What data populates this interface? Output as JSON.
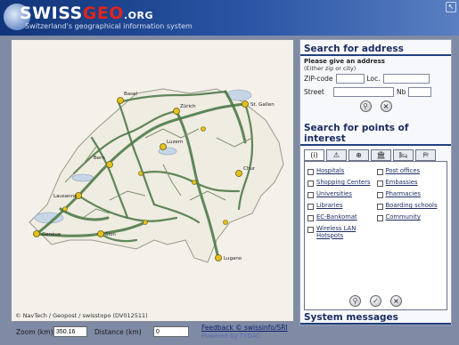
{
  "header": {
    "logo_swiss": "SWISS",
    "logo_geo": "GEO",
    "logo_org": ".ORG",
    "tagline": "Switzerland's geographical information system",
    "corner_glyph": "↖"
  },
  "map": {
    "copyright": "© NavTech / Geopost / swisstopo (DV012511)",
    "city_labels": [
      "Basel",
      "Zürich",
      "St. Gallen",
      "Luzern",
      "Genève",
      "Sion",
      "Lugano",
      "Bern",
      "Chur",
      "Lausanne"
    ],
    "colors": {
      "land": "#f3f1ea",
      "road": "#4f7b4a",
      "city": "#e3c21b"
    }
  },
  "address": {
    "title": "Search for address",
    "hint": "Please give an address",
    "hint_sub": "(Either zip or city)",
    "zip_label": "ZIP-code",
    "loc_label": "Loc.",
    "street_label": "Street",
    "nb_label": "Nb",
    "zip_value": "",
    "loc_value": "",
    "street_value": "",
    "nb_value": "",
    "search_icon": "search-icon",
    "clear_icon": "close-icon"
  },
  "poi": {
    "title": "Search for points of interest",
    "tabs": [
      "(i)",
      "⚠",
      "⊕",
      "🏛",
      "🛏",
      "⛿"
    ],
    "items": [
      "Hospitals",
      "Post offices",
      "Shopping Centers",
      "Embassies",
      "Universities",
      "Pharmacies",
      "Libraries",
      "Boarding schools",
      "EC-Bankomat",
      "Community",
      "Wireless LAN Hotspots",
      ""
    ]
  },
  "system": {
    "title": "System messages"
  },
  "bottom": {
    "zoom_label": "Zoom (km)",
    "zoom_value": "350.16",
    "distance_label": "Distance (km)",
    "distance_value": "0",
    "feedback": "Feedback © swissinfo/SRI",
    "powered": "Powered by TYDAC"
  }
}
